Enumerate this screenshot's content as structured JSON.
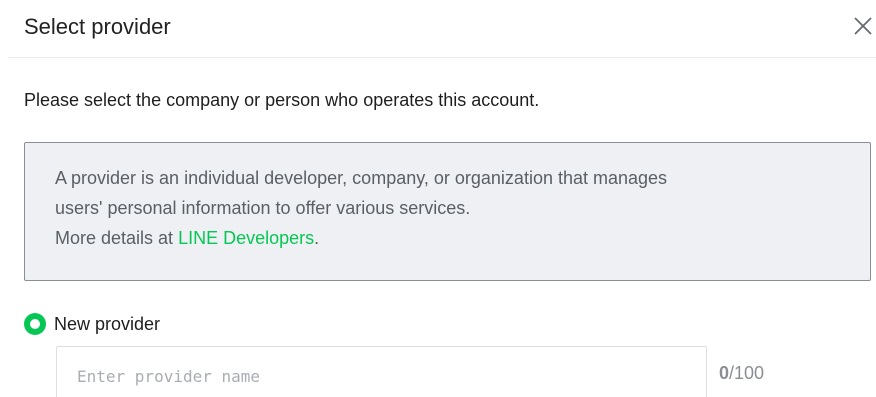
{
  "dialog": {
    "title": "Select provider",
    "close_icon": "close-icon"
  },
  "description": "Please select the company or person who operates this account.",
  "info": {
    "line1": "A provider is an individual developer, company, or organization that manages",
    "line2": "users' personal information to offer various services.",
    "line3_prefix": "More details at ",
    "link_text": "LINE Developers",
    "line3_suffix": "."
  },
  "options": {
    "new_provider_label": "New provider",
    "selected": true
  },
  "provider_input": {
    "placeholder": "Enter provider name",
    "value": ""
  },
  "counter": {
    "current": "0",
    "max": "/100"
  },
  "colors": {
    "accent": "#06c755",
    "info_background": "#eef0f3",
    "info_border": "#8a8e95"
  }
}
